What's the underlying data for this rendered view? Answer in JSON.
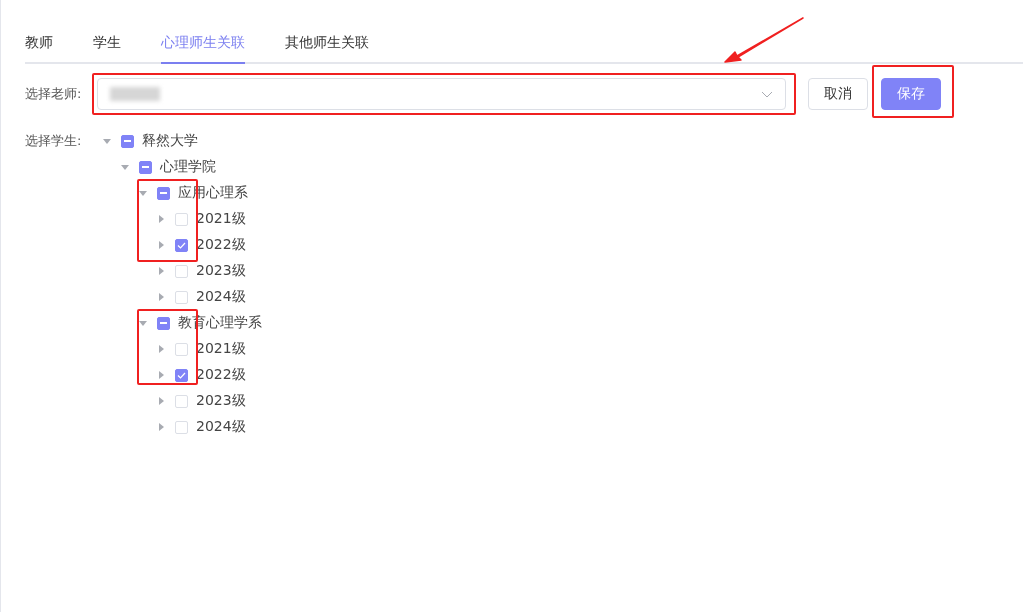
{
  "tabs": [
    {
      "label": "教师",
      "selected": false
    },
    {
      "label": "学生",
      "selected": false
    },
    {
      "label": "心理师生关联",
      "selected": true
    },
    {
      "label": "其他师生关联",
      "selected": false
    }
  ],
  "teacher_select": {
    "label": "选择老师:"
  },
  "buttons": [
    {
      "label": "取消",
      "kind": "default"
    },
    {
      "label": "保存",
      "kind": "primary"
    }
  ],
  "student_tree": {
    "label": "选择学生:",
    "nodes": [
      {
        "label": "释然大学",
        "expanded": true,
        "indeterminate": true,
        "children": [
          {
            "label": "心理学院",
            "expanded": true,
            "indeterminate": true,
            "children": [
              {
                "label": "应用心理系",
                "expanded": true,
                "indeterminate": true,
                "children": [
                  {
                    "label": "2021级",
                    "expanded": false,
                    "checked": false
                  },
                  {
                    "label": "2022级",
                    "expanded": false,
                    "checked": true
                  },
                  {
                    "label": "2023级",
                    "expanded": false,
                    "checked": false
                  },
                  {
                    "label": "2024级",
                    "expanded": false,
                    "checked": false
                  }
                ]
              },
              {
                "label": "教育心理学系",
                "expanded": true,
                "indeterminate": true,
                "children": [
                  {
                    "label": "2021级",
                    "expanded": false,
                    "checked": false
                  },
                  {
                    "label": "2022级",
                    "expanded": false,
                    "checked": true
                  },
                  {
                    "label": "2023级",
                    "expanded": false,
                    "checked": false
                  },
                  {
                    "label": "2024级",
                    "expanded": false,
                    "checked": false
                  }
                ]
              }
            ]
          }
        ]
      }
    ]
  }
}
